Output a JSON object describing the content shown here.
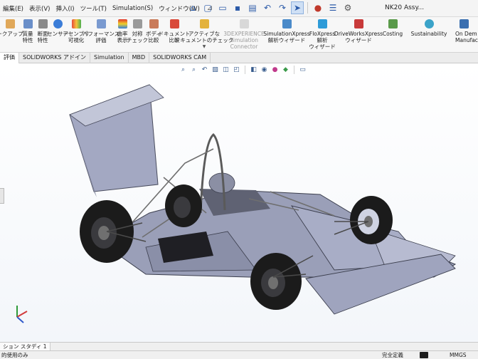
{
  "menubar": {
    "items": [
      "編集(E)",
      "表示(V)",
      "挿入(I)",
      "ツール(T)",
      "Simulation(S)",
      "ウィンドウ(W)"
    ],
    "pin": "📌",
    "document_title": "NK20 Assy..."
  },
  "ribbon": {
    "items": [
      {
        "label1": "ークアップ",
        "label2": ""
      },
      {
        "label1": "質量",
        "label2": "特性"
      },
      {
        "label1": "断面",
        "label2": "特性"
      },
      {
        "label1": "センサー",
        "label2": ""
      },
      {
        "label1": "アセンブリ",
        "label2": "可視化"
      },
      {
        "label1": "パフォーマンス",
        "label2": "評価"
      },
      {
        "label1": "曲率",
        "label2": "表示"
      },
      {
        "label1": "対称",
        "label2": "チェック"
      },
      {
        "label1": "ボディ",
        "label2": "比較"
      },
      {
        "label1": "ドキュメント",
        "label2": "比較"
      },
      {
        "label1": "アクティブな",
        "label2": "ドキュメントのチェック"
      },
      {
        "label1": "3DEXPERIENCE",
        "label2": "Simulation",
        "label3": "Connector"
      },
      {
        "label1": "SimulationXpress",
        "label2": "解析ウィザード"
      },
      {
        "label1": "FloXpress",
        "label2": "解析",
        "label3": "ウィザード"
      },
      {
        "label1": "DriveWorksXpress",
        "label2": "ウィザード"
      },
      {
        "label1": "Costing",
        "label2": ""
      },
      {
        "label1": "Sustainability",
        "label2": ""
      },
      {
        "label1": "On Dem",
        "label2": "Manufact"
      }
    ]
  },
  "tabs": [
    "評価",
    "SOLIDWORKS アドイン",
    "Simulation",
    "MBD",
    "SOLIDWORKS CAM"
  ],
  "motion_tabs": [
    "ション スタディ 1"
  ],
  "status": {
    "left": "的使用のみ",
    "definition": "完全定義",
    "units": "MMGS"
  },
  "colors": {
    "body": "#9a9fb8",
    "tire": "#1b1b1b",
    "frame": "#6f6f6f",
    "accent": "#2b5aa8"
  }
}
